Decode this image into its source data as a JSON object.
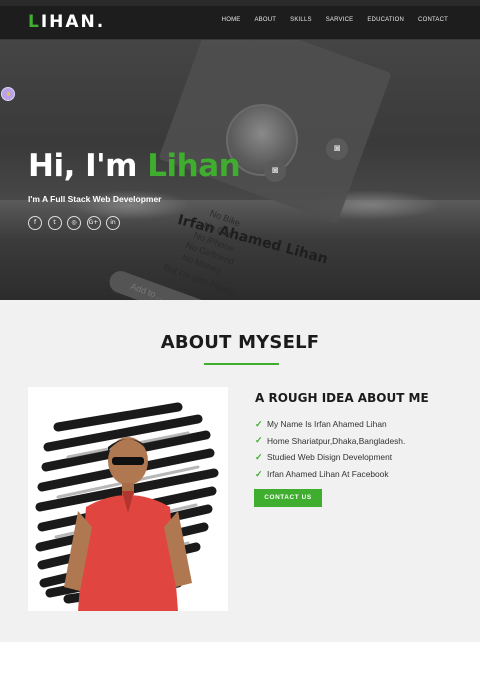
{
  "navbar": {
    "logo_first": "L",
    "logo_rest": "IHAN.",
    "links": [
      "HOME",
      "ABOUT",
      "SKILLS",
      "SARVICE",
      "EDUCATION",
      "CONTACT"
    ]
  },
  "hero": {
    "greeting": "Hi, I'm ",
    "name": "Lihan",
    "tagline": "I'm A Full Stack Web Developmer",
    "card_name": "Irfan Ahamed Lihan",
    "card_lines": [
      "No Bike",
      "No Car",
      "No iPhone",
      "No Girlfriend",
      "No Money",
      "But I'm also Happy"
    ],
    "card_button": "Add to ...",
    "socials": [
      "facebook-icon",
      "twitter-icon",
      "instagram-icon",
      "google-plus-icon",
      "linkedin-icon"
    ],
    "social_glyphs": [
      "f",
      "t",
      "◎",
      "G+",
      "in"
    ]
  },
  "about": {
    "title": "ABOUT MYSELF",
    "subhead": "A ROUGH IDEA ABOUT ME",
    "facts": [
      "My Name Is Irfan Ahamed Lihan",
      "Home Shariatpur,Dhaka,Bangladesh.",
      "Studied Web Disign Development",
      "Irfan Ahamed Lihan At Facebook"
    ],
    "contact_label": "CONTACT US"
  },
  "colors": {
    "accent": "#3fae2e",
    "navbar": "#1d1d1d",
    "about_bg": "#f1f1f1"
  }
}
